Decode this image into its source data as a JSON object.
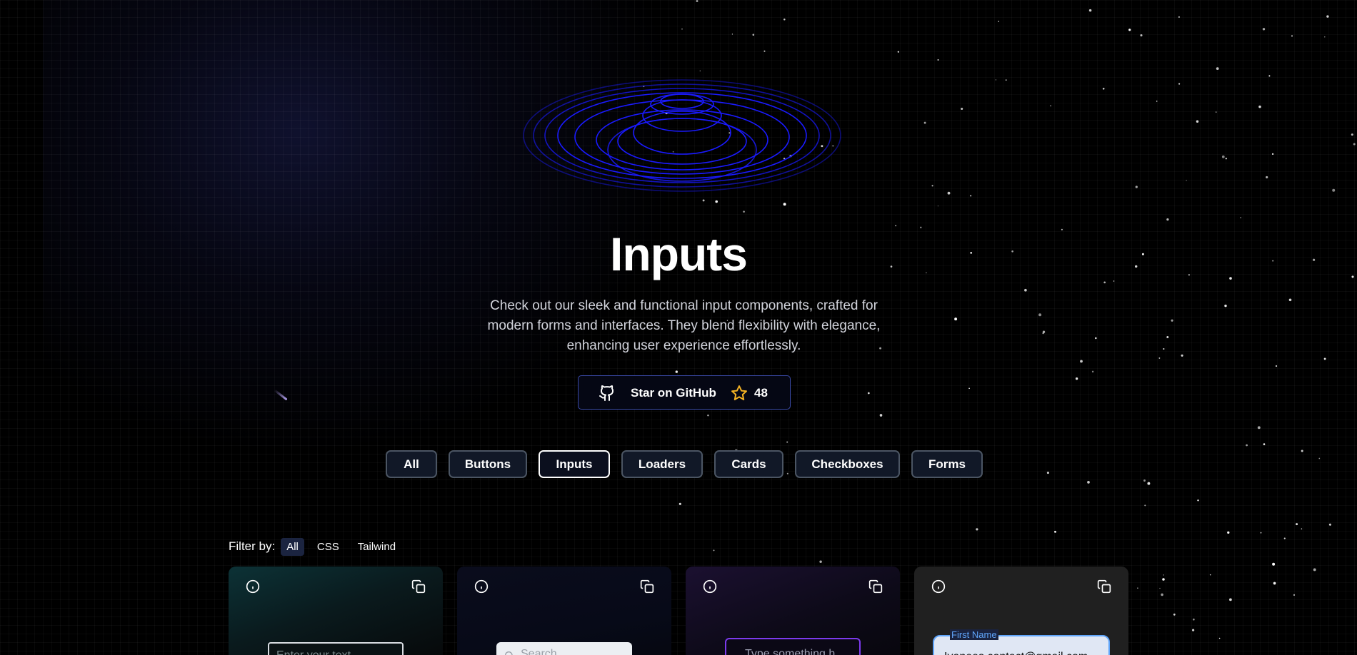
{
  "hero": {
    "title": "Inputs",
    "subtitle": "Check out our sleek and functional input components, crafted for modern forms and interfaces. They blend flexibility with elegance, enhancing user experience effortlessly."
  },
  "github": {
    "label": "Star on GitHub",
    "stars": "48",
    "icon": "github-icon",
    "star_icon": "star-icon",
    "star_color": "#f5b324",
    "border_color": "#3a4aa8"
  },
  "tabs": [
    {
      "label": "All",
      "active": false
    },
    {
      "label": "Buttons",
      "active": false
    },
    {
      "label": "Inputs",
      "active": true
    },
    {
      "label": "Loaders",
      "active": false
    },
    {
      "label": "Cards",
      "active": false
    },
    {
      "label": "Checkboxes",
      "active": false
    },
    {
      "label": "Forms",
      "active": false
    }
  ],
  "filter": {
    "label": "Filter by:",
    "options": [
      "All",
      "CSS",
      "Tailwind"
    ],
    "selected": "All"
  },
  "cards": [
    {
      "placeholder": "Enter your text",
      "icons": [
        "info-icon",
        "copy-icon"
      ]
    },
    {
      "placeholder": "Search",
      "icons": [
        "info-icon",
        "copy-icon",
        "search-icon"
      ]
    },
    {
      "placeholder": "Type something h",
      "icons": [
        "info-icon",
        "copy-icon"
      ]
    },
    {
      "label": "First Name",
      "value": "Ivanees.contact@gmail.com",
      "icons": [
        "info-icon",
        "copy-icon"
      ]
    }
  ],
  "colors": {
    "background": "#000000",
    "ring": "#1a1aff",
    "tab_bg": "#111827",
    "tab_border": "#4b5563",
    "active_tab_border": "#ffffff",
    "purple_accent": "#7c3aed",
    "blue_accent": "#60a5fa"
  }
}
